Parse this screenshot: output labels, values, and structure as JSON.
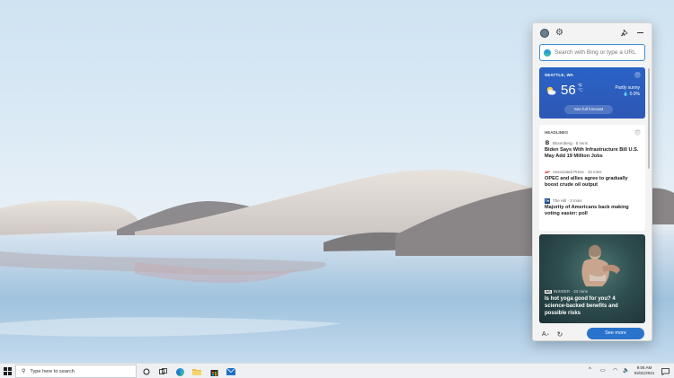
{
  "flyout": {
    "search": {
      "placeholder": "Search with Bing or type a URL"
    },
    "weather": {
      "location": "SEATTLE, WA",
      "temperature": "56",
      "unit_f": "°F",
      "unit_c": "°C",
      "condition": "Partly sunny",
      "precipitation": "0.0%",
      "forecast_button": "See full forecast",
      "more": "···"
    },
    "headlines": {
      "title": "HEADLINES",
      "more": "···",
      "stories": [
        {
          "logo": "B",
          "source": "Bloomberg · 8 mins",
          "headline": "Biden Says With Infrastructure Bill U.S. May Add 19 Million Jobs"
        },
        {
          "logo": "AP",
          "source": "Associated Press · 15 mins",
          "headline": "OPEC and allies agree to gradually boost crude oil output"
        },
        {
          "logo": "TH",
          "source": "The Hill · 3 mins",
          "headline": "Majority of Americans back making voting easier: poll"
        }
      ]
    },
    "image_story": {
      "logo": "INS",
      "source": "INSIDER · 33 mins",
      "headline": "Is hot yoga good for you? 4 science-backed benefits and possible risks"
    },
    "see_more": "See more"
  },
  "taskbar": {
    "search_text": "Type here to search",
    "time": "9:05 AM",
    "date": "03/31/2021"
  },
  "colors": {
    "weather_card": "#2a62c5",
    "see_more_button": "#2a73cc",
    "search_focus": "#3d8fd6"
  }
}
